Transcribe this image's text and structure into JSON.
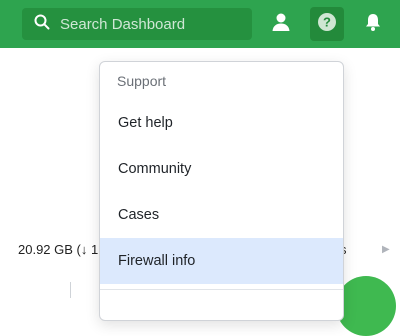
{
  "search": {
    "placeholder": "Search Dashboard"
  },
  "header_icons": [
    "search-icon",
    "user-icon",
    "help-icon",
    "bell-icon"
  ],
  "colors": {
    "header_bg": "#2ea44f",
    "highlight": "#dce9fd",
    "accent_active": "#238a3b"
  },
  "content": {
    "stat_left": "20.92 GB (↓ 1",
    "stat_right": "s"
  },
  "support_menu": {
    "heading": "Support",
    "items": [
      {
        "label": "Get help"
      },
      {
        "label": "Community"
      },
      {
        "label": "Cases"
      },
      {
        "label": "Firewall info",
        "highlighted": true
      }
    ]
  }
}
